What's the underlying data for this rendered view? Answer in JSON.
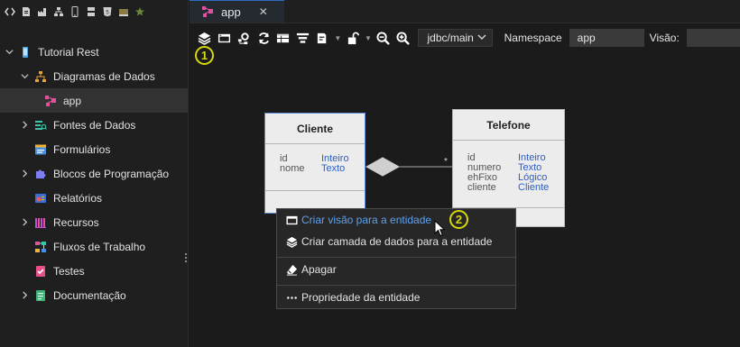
{
  "left_toolbar": {
    "icons": [
      "code-icon",
      "file-icon",
      "factory-icon",
      "stack-icon",
      "mobile-icon",
      "server-icon",
      "html5-icon",
      "folder-icon",
      "star-icon"
    ]
  },
  "tree": {
    "project": "Tutorial Rest",
    "data_diagrams": "Diagramas de Dados",
    "app_item": "app",
    "data_sources": "Fontes de Dados",
    "forms": "Formulários",
    "blocks": "Blocos de Programação",
    "reports": "Relatórios",
    "resources": "Recursos",
    "workflows": "Fluxos de Trabalho",
    "tests": "Testes",
    "documentation": "Documentação"
  },
  "tab": {
    "label": "app",
    "close": "✕"
  },
  "toolbar": {
    "datasource_selected": "jdbc/main",
    "namespace_label": "Namespace",
    "namespace_value": "app",
    "view_label": "Visão:"
  },
  "badges": {
    "step1": "1",
    "step2": "2"
  },
  "entities": {
    "cliente": {
      "title": "Cliente",
      "attributes": [
        "id",
        "nome"
      ],
      "types": [
        "Inteiro",
        "Texto"
      ]
    },
    "telefone": {
      "title": "Telefone",
      "attributes": [
        "id",
        "numero",
        "ehFixo",
        "cliente"
      ],
      "types": [
        "Inteiro",
        "Texto",
        "Lógico",
        "Cliente"
      ]
    },
    "relation_multiplicity": "*"
  },
  "context_menu": {
    "create_view": "Criar visão para a entidade",
    "create_layer": "Criar camada de dados para a entidade",
    "delete": "Apagar",
    "properties": "Propriedade da entidade"
  },
  "colors": {
    "accent": "#2d6cc0",
    "link_blue": "#5ea0ee",
    "badge_yellow": "#d7d80d",
    "type_blue": "#2b5fc8"
  }
}
